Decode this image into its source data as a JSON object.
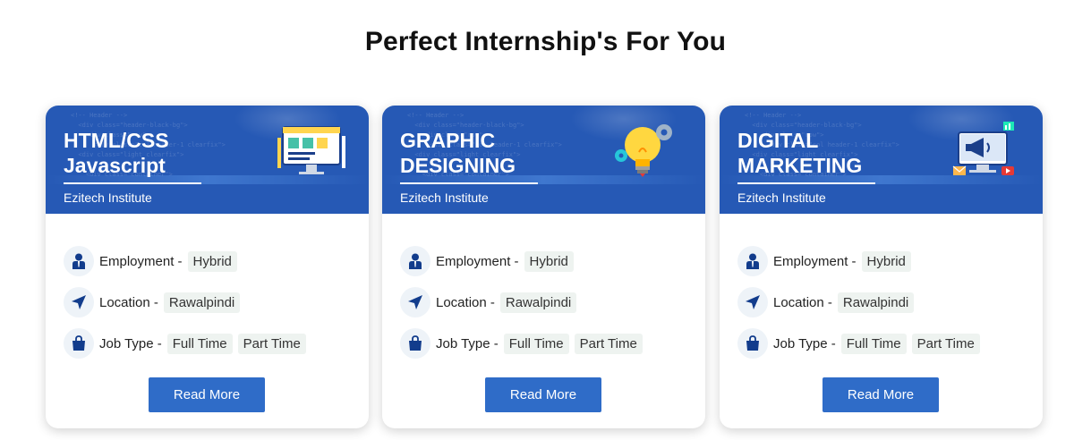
{
  "page": {
    "title": "Perfect Internship's For You"
  },
  "labels": {
    "employment": "Employment -",
    "location": "Location -",
    "job_type": "Job Type -"
  },
  "icons": {
    "employment": "person-icon",
    "location": "location-arrow-icon",
    "job_type": "shopping-bag-icon"
  },
  "colors": {
    "header": "#2659b5",
    "button": "#2f6cc8",
    "icon": "#123c8c"
  },
  "cards": [
    {
      "title": "HTML/CSS\nJavascript",
      "institute": "Ezitech Institute",
      "illustration": "web-design-icon",
      "employment": "Hybrid",
      "location": "Rawalpindi",
      "job_types": [
        "Full Time",
        "Part Time"
      ],
      "button": "Read More"
    },
    {
      "title": "GRAPHIC\nDESIGNING",
      "institute": "Ezitech Institute",
      "illustration": "lightbulb-gears-icon",
      "employment": "Hybrid",
      "location": "Rawalpindi",
      "job_types": [
        "Full Time",
        "Part Time"
      ],
      "button": "Read More"
    },
    {
      "title": "DIGITAL\nMARKETING",
      "institute": "Ezitech Institute",
      "illustration": "megaphone-monitor-icon",
      "employment": "Hybrid",
      "location": "Rawalpindi",
      "job_types": [
        "Full Time",
        "Part Time"
      ],
      "button": "Read More"
    }
  ]
}
